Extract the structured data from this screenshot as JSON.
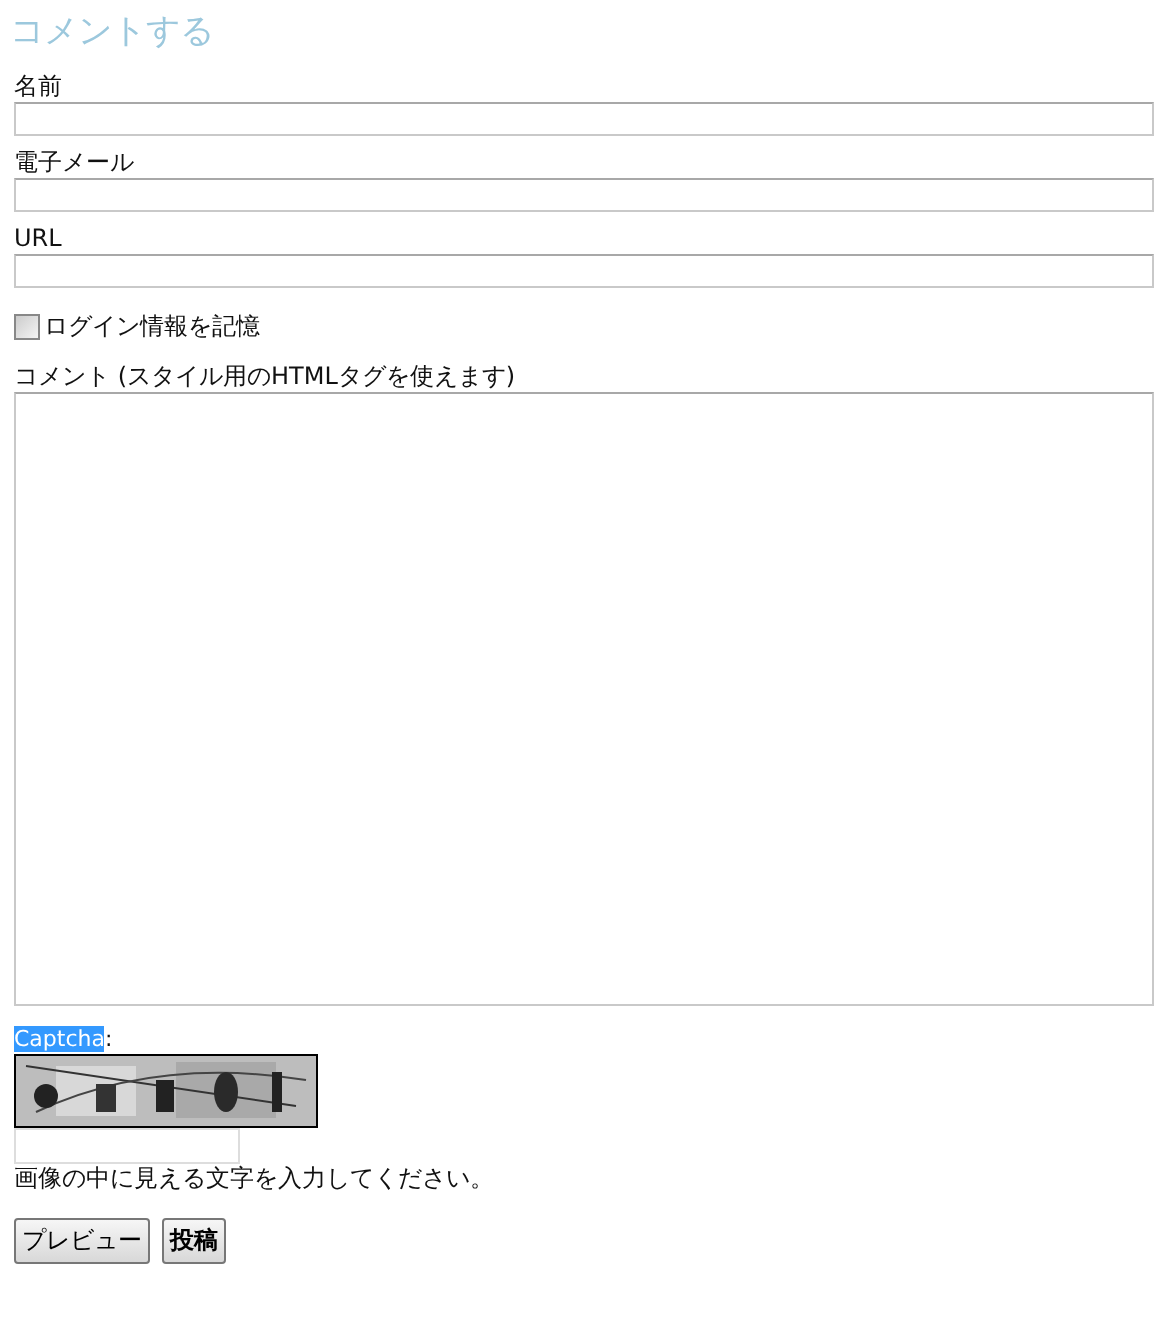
{
  "title": "コメントする",
  "fields": [
    {
      "label": "名前"
    },
    {
      "label": "電子メール"
    },
    {
      "label": "URL"
    }
  ],
  "remember": {
    "label": "ログイン情報を記憶",
    "checked": false
  },
  "comment": {
    "label": "コメント (スタイル用のHTMLタグを使えます)"
  },
  "captcha": {
    "label": "Captcha",
    "highlighted": true,
    "suffix": ":",
    "hint": "画像の中に見える文字を入力してください。"
  },
  "buttons": [
    {
      "label": "プレビュー",
      "bold": false
    },
    {
      "label": "投稿",
      "bold": true
    }
  ]
}
